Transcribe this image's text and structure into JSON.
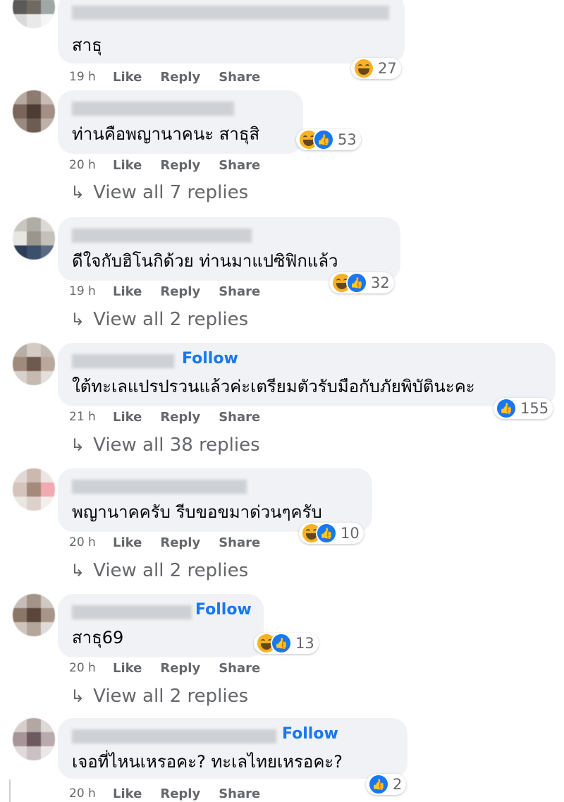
{
  "comments": [
    {
      "text": "สาธุ",
      "time": "19 h",
      "reaction_count": "27",
      "reactions": [
        "haha"
      ]
    },
    {
      "text": "ท่านคือพญานาคนะ สาธุสิ",
      "time": "20 h",
      "reaction_count": "53",
      "reactions": [
        "haha",
        "like"
      ],
      "view_replies": "View all 7 replies"
    },
    {
      "text": "ดีใจกับฮิโนกิด้วย ท่านมาแปซิฟิกแล้ว",
      "time": "19 h",
      "reaction_count": "32",
      "reactions": [
        "haha",
        "like"
      ],
      "view_replies": "View all 2 replies"
    },
    {
      "text": "ใต้ทะเลแปรปรวนแล้วค่ะเตรียมตัวรับมือกับภัยพิบัตินะคะ",
      "time": "21 h",
      "follow": "Follow",
      "reaction_count": "155",
      "reactions": [
        "like"
      ],
      "view_replies": "View all 38 replies"
    },
    {
      "text": "พญานาคครับ รีบขอขมาด่วนๆครับ",
      "time": "20 h",
      "reaction_count": "10",
      "reactions": [
        "haha",
        "like"
      ],
      "view_replies": "View all 2 replies"
    },
    {
      "text": "สาธุ69",
      "time": "20 h",
      "follow": "Follow",
      "reaction_count": "13",
      "reactions": [
        "haha",
        "like"
      ],
      "view_replies": "View all 2 replies"
    },
    {
      "text": "เจอที่ไหนเหรอคะ? ทะเลไทยเหรอคะ?",
      "time": "20 h",
      "follow": "Follow",
      "reaction_count": "2",
      "reactions": [
        "like"
      ]
    }
  ],
  "actions": {
    "like": "Like",
    "reply": "Reply",
    "share": "Share"
  },
  "icons": {
    "reply_arrow": "↳",
    "like_glyph": "👍"
  },
  "colors": {
    "bubble": "#f0f2f5",
    "link": "#1877f2",
    "meta": "#65676b",
    "like": "#1877f2",
    "haha": "#f7b125"
  }
}
